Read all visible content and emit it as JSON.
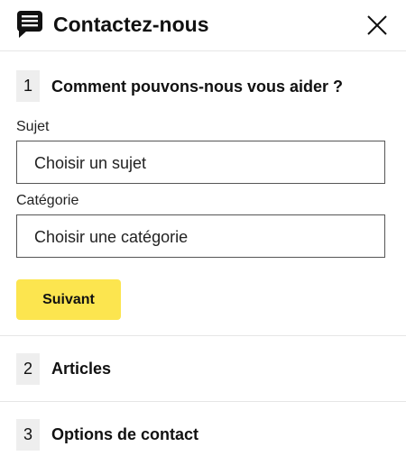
{
  "header": {
    "icon": "chat-bubble-icon",
    "title": "Contactez-nous",
    "close_icon": "close-icon"
  },
  "steps": [
    {
      "number": "1",
      "title": "Comment pouvons-nous vous aider ?",
      "fields": [
        {
          "label": "Sujet",
          "value": "Choisir un sujet"
        },
        {
          "label": "Catégorie",
          "value": "Choisir une catégorie"
        }
      ],
      "next_label": "Suivant"
    },
    {
      "number": "2",
      "title": "Articles"
    },
    {
      "number": "3",
      "title": "Options de contact"
    }
  ],
  "colors": {
    "accent": "#fce54f",
    "badge_bg": "#eeeeee",
    "border": "#555555",
    "divider": "#e6e6e6"
  }
}
